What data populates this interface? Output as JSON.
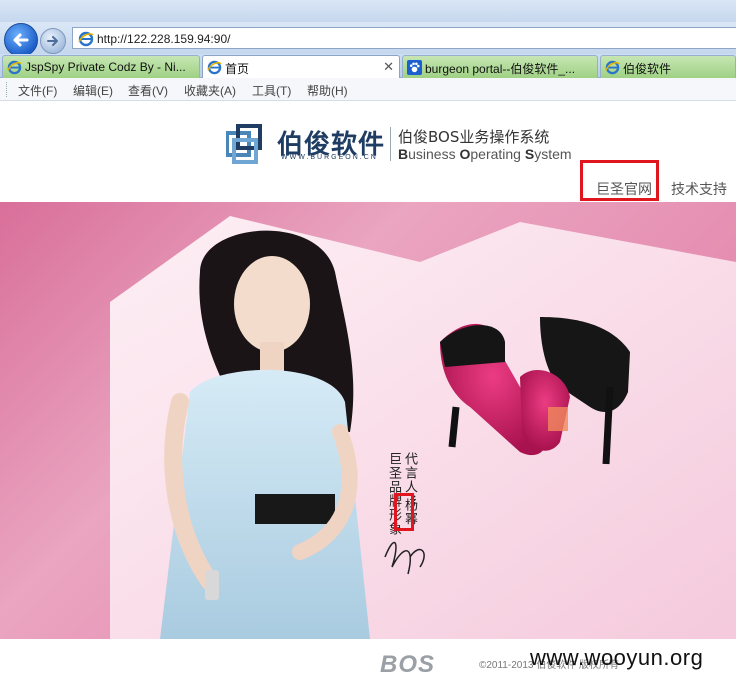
{
  "browser": {
    "title_bar_text": "",
    "address_url": "http://122.228.159.94:90/",
    "tabs": [
      {
        "label": "JspSpy Private Codz By - Ni..."
      },
      {
        "label": "首页"
      },
      {
        "label": "burgeon portal--伯俊软件_..."
      },
      {
        "label": "伯俊软件"
      }
    ],
    "menu": [
      "文件(F)",
      "编辑(E)",
      "查看(V)",
      "收藏夹(A)",
      "工具(T)",
      "帮助(H)"
    ]
  },
  "page": {
    "brand_name": "伯俊软件",
    "brand_url": "WWW.BURGEON.CN",
    "system_title_cn": "伯俊BOS业务操作系统",
    "system_title_en": {
      "b1": "B",
      "r1": "usiness ",
      "b2": "O",
      "r2": "perating ",
      "b3": "S",
      "r3": "ystem"
    },
    "nav_links": [
      "巨圣官网",
      "技术支持申"
    ],
    "hero": {
      "vertical_text_col1": "代言人：",
      "vertical_text_col2": "巨圣品牌形象",
      "name_boxed": "杨幂"
    },
    "footer": {
      "logo_text": "BOS",
      "copyright": "©2011-2013 伯俊软件 版权所有"
    },
    "watermark": "www.wooyun.org"
  },
  "colors": {
    "highlight_box": "#e0151d",
    "brand": "#1f3d63",
    "hero_pink": "#e58cb0"
  }
}
